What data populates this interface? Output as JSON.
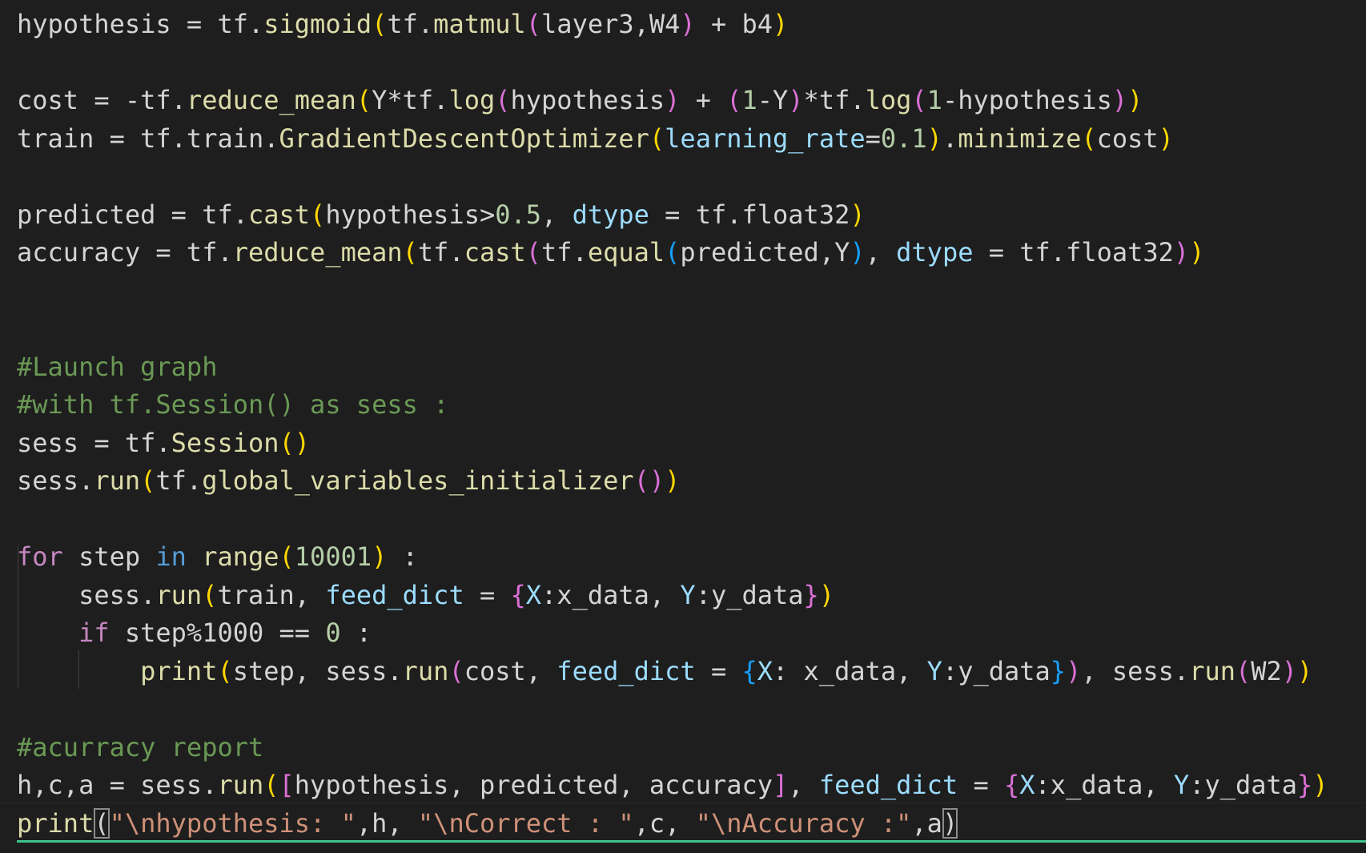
{
  "editor": {
    "lines": [
      [
        [
          "txt",
          "hypothesis = tf."
        ],
        [
          "fn",
          "sigmoid"
        ],
        [
          "b1",
          "("
        ],
        [
          "txt",
          "tf."
        ],
        [
          "fn",
          "matmul"
        ],
        [
          "b2",
          "("
        ],
        [
          "txt",
          "layer3,W4"
        ],
        [
          "b2",
          ")"
        ],
        [
          "txt",
          " + b4"
        ],
        [
          "b1",
          ")"
        ]
      ],
      [],
      [
        [
          "txt",
          "cost = -tf."
        ],
        [
          "fn",
          "reduce_mean"
        ],
        [
          "b1",
          "("
        ],
        [
          "txt",
          "Y*tf."
        ],
        [
          "fn",
          "log"
        ],
        [
          "b2",
          "("
        ],
        [
          "txt",
          "hypothesis"
        ],
        [
          "b2",
          ")"
        ],
        [
          "txt",
          " + "
        ],
        [
          "b2",
          "("
        ],
        [
          "num",
          "1"
        ],
        [
          "txt",
          "-Y"
        ],
        [
          "b2",
          ")"
        ],
        [
          "txt",
          "*tf."
        ],
        [
          "fn",
          "log"
        ],
        [
          "b2",
          "("
        ],
        [
          "num",
          "1"
        ],
        [
          "txt",
          "-hypothesis"
        ],
        [
          "b2",
          ")"
        ],
        [
          "b1",
          ")"
        ]
      ],
      [
        [
          "txt",
          "train = tf.train."
        ],
        [
          "fn",
          "GradientDescentOptimizer"
        ],
        [
          "b1",
          "("
        ],
        [
          "prm",
          "learning_rate"
        ],
        [
          "txt",
          "="
        ],
        [
          "num",
          "0.1"
        ],
        [
          "b1",
          ")"
        ],
        [
          "txt",
          "."
        ],
        [
          "fn",
          "minimize"
        ],
        [
          "b1",
          "("
        ],
        [
          "txt",
          "cost"
        ],
        [
          "b1",
          ")"
        ]
      ],
      [],
      [
        [
          "txt",
          "predicted = tf."
        ],
        [
          "fn",
          "cast"
        ],
        [
          "b1",
          "("
        ],
        [
          "txt",
          "hypothesis>"
        ],
        [
          "num",
          "0.5"
        ],
        [
          "txt",
          ", "
        ],
        [
          "prm",
          "dtype"
        ],
        [
          "txt",
          " = tf.float32"
        ],
        [
          "b1",
          ")"
        ]
      ],
      [
        [
          "txt",
          "accuracy = tf."
        ],
        [
          "fn",
          "reduce_mean"
        ],
        [
          "b1",
          "("
        ],
        [
          "txt",
          "tf."
        ],
        [
          "fn",
          "cast"
        ],
        [
          "b2",
          "("
        ],
        [
          "txt",
          "tf."
        ],
        [
          "fn",
          "equal"
        ],
        [
          "b3",
          "("
        ],
        [
          "txt",
          "predicted,Y"
        ],
        [
          "b3",
          ")"
        ],
        [
          "txt",
          ", "
        ],
        [
          "prm",
          "dtype"
        ],
        [
          "txt",
          " = tf.float32"
        ],
        [
          "b2",
          ")"
        ],
        [
          "b1",
          ")"
        ]
      ],
      [],
      [],
      [
        [
          "com",
          "#Launch graph"
        ]
      ],
      [
        [
          "com",
          "#with tf.Session() as sess :"
        ]
      ],
      [
        [
          "txt",
          "sess = tf."
        ],
        [
          "fn",
          "Session"
        ],
        [
          "b1",
          "()"
        ]
      ],
      [
        [
          "txt",
          "sess."
        ],
        [
          "fn",
          "run"
        ],
        [
          "b1",
          "("
        ],
        [
          "txt",
          "tf."
        ],
        [
          "fn",
          "global_variables_initializer"
        ],
        [
          "b2",
          "()"
        ],
        [
          "b1",
          ")"
        ]
      ],
      [],
      [
        [
          "kwc",
          "for"
        ],
        [
          "txt",
          " step "
        ],
        [
          "kw",
          "in"
        ],
        [
          "txt",
          " "
        ],
        [
          "fn",
          "range"
        ],
        [
          "b1",
          "("
        ],
        [
          "num",
          "10001"
        ],
        [
          "b1",
          ")"
        ],
        [
          "txt",
          " :"
        ]
      ],
      [
        [
          "txt",
          "    sess."
        ],
        [
          "fn",
          "run"
        ],
        [
          "b1",
          "("
        ],
        [
          "txt",
          "train, "
        ],
        [
          "prm",
          "feed_dict"
        ],
        [
          "txt",
          " = "
        ],
        [
          "b2",
          "{"
        ],
        [
          "prm",
          "X"
        ],
        [
          "txt",
          ":x_data, "
        ],
        [
          "prm",
          "Y"
        ],
        [
          "txt",
          ":y_data"
        ],
        [
          "b2",
          "}"
        ],
        [
          "b1",
          ")"
        ]
      ],
      [
        [
          "txt",
          "    "
        ],
        [
          "kwc",
          "if"
        ],
        [
          "txt",
          " step%1000 == "
        ],
        [
          "num",
          "0"
        ],
        [
          "txt",
          " :"
        ]
      ],
      [
        [
          "txt",
          "        "
        ],
        [
          "fn",
          "print"
        ],
        [
          "b1",
          "("
        ],
        [
          "txt",
          "step, sess."
        ],
        [
          "fn",
          "run"
        ],
        [
          "b2",
          "("
        ],
        [
          "txt",
          "cost, "
        ],
        [
          "prm",
          "feed_dict"
        ],
        [
          "txt",
          " = "
        ],
        [
          "b3",
          "{"
        ],
        [
          "prm",
          "X"
        ],
        [
          "txt",
          ": x_data, "
        ],
        [
          "prm",
          "Y"
        ],
        [
          "txt",
          ":y_data"
        ],
        [
          "b3",
          "}"
        ],
        [
          "b2",
          ")"
        ],
        [
          "txt",
          ", sess."
        ],
        [
          "fn",
          "run"
        ],
        [
          "b2",
          "("
        ],
        [
          "txt",
          "W2"
        ],
        [
          "b2",
          ")"
        ],
        [
          "b1",
          ")"
        ]
      ],
      [],
      [
        [
          "com",
          "#acurracy report"
        ]
      ],
      [
        [
          "txt",
          "h,c,a = sess."
        ],
        [
          "fn",
          "run"
        ],
        [
          "b1",
          "("
        ],
        [
          "b2",
          "["
        ],
        [
          "txt",
          "hypothesis, predicted, accuracy"
        ],
        [
          "b2",
          "]"
        ],
        [
          "txt",
          ", "
        ],
        [
          "prm",
          "feed_dict"
        ],
        [
          "txt",
          " = "
        ],
        [
          "b2",
          "{"
        ],
        [
          "prm",
          "X"
        ],
        [
          "txt",
          ":x_data, "
        ],
        [
          "prm",
          "Y"
        ],
        [
          "txt",
          ":y_data"
        ],
        [
          "b2",
          "}"
        ],
        [
          "b1",
          ")"
        ]
      ],
      [
        [
          "fn",
          "print"
        ],
        [
          "bm",
          "("
        ],
        [
          "str",
          "\"\\nhypothesis: \""
        ],
        [
          "txt",
          ",h, "
        ],
        [
          "str",
          "\"\\nCorrect : \""
        ],
        [
          "txt",
          ",c, "
        ],
        [
          "str",
          "\"\\nAccuracy :\""
        ],
        [
          "txt",
          ",a"
        ],
        [
          "bm",
          ")"
        ]
      ]
    ],
    "current_line_index": 21
  }
}
